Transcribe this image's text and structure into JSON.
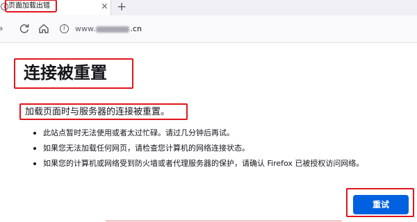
{
  "tab": {
    "title": "页面加载出错",
    "info_icon": "i",
    "close_icon": "×",
    "new_tab_icon": "+"
  },
  "nav": {
    "forward_icon": "→",
    "reload_icon": "reload-icon",
    "home_icon": "home-icon",
    "url_info_icon": "i",
    "url_prefix": "www.",
    "url_suffix": ".cn",
    "url_host_hint": "jie...quan"
  },
  "error": {
    "title": "连接被重置",
    "subtitle": "加载页面时与服务器的连接被重置。",
    "bullets": [
      "此站点暂时无法使用或者太过忙碌。请过几分钟后再试。",
      "如果您无法加载任何网页，请检查您计算机的网络连接状态。",
      "如果您的计算机或网络受到防火墙或者代理服务器的保护，请确认 Firefox 已被授权访问网络。"
    ],
    "retry_label": "重试"
  },
  "colors": {
    "highlight_box": "#e0141b",
    "primary_button": "#0061e0"
  }
}
